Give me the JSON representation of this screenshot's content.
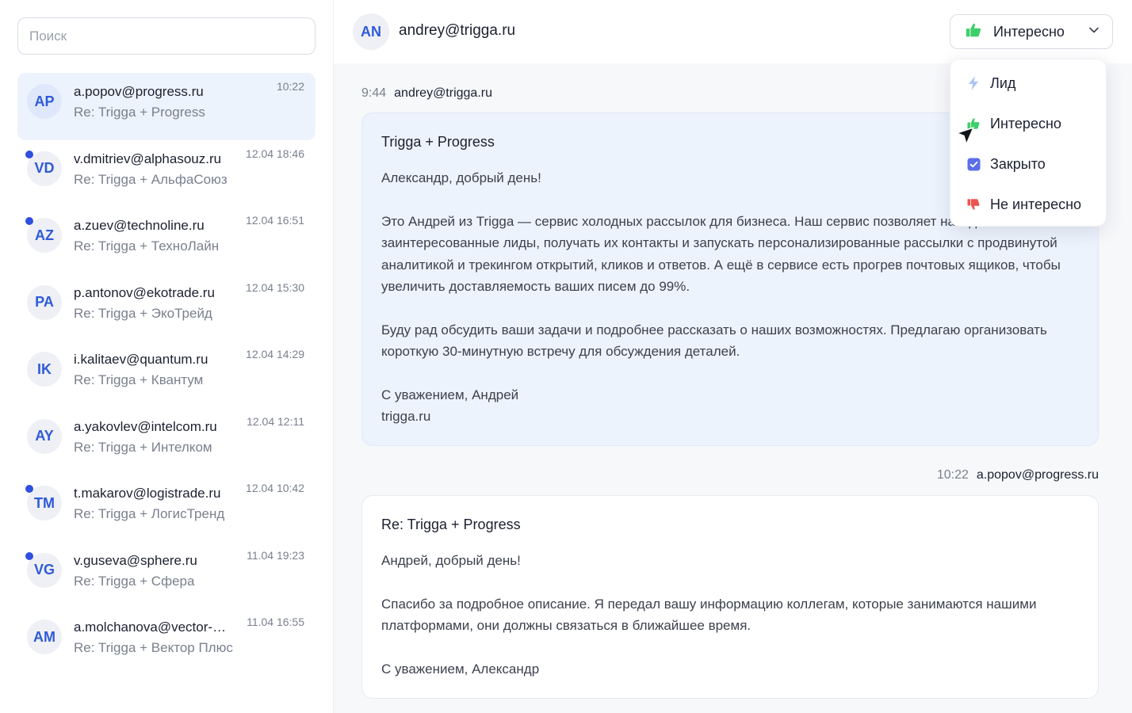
{
  "search": {
    "placeholder": "Поиск"
  },
  "conversations": [
    {
      "initials": "AP",
      "email": "a.popov@progress.ru",
      "subject": "Re: Trigga + Progress",
      "time": "10:22"
    },
    {
      "initials": "VD",
      "email": "v.dmitriev@alphasouz.ru",
      "subject": "Re: Trigga + АльфаСоюз",
      "time": "12.04 18:46"
    },
    {
      "initials": "AZ",
      "email": "a.zuev@technoline.ru",
      "subject": "Re: Trigga + ТехноЛайн",
      "time": "12.04 16:51"
    },
    {
      "initials": "PA",
      "email": "p.antonov@ekotrade.ru",
      "subject": "Re: Trigga + ЭкоТрейд",
      "time": "12.04 15:30"
    },
    {
      "initials": "IK",
      "email": "i.kalitaev@quantum.ru",
      "subject": "Re: Trigga + Квантум",
      "time": "12.04 14:29"
    },
    {
      "initials": "AY",
      "email": "a.yakovlev@intelcom.ru",
      "subject": "Re: Trigga + Интелком",
      "time": "12.04 12:11"
    },
    {
      "initials": "TM",
      "email": "t.makarov@logistrade.ru",
      "subject": "Re: Trigga + ЛогисТренд",
      "time": "12.04 10:42"
    },
    {
      "initials": "VG",
      "email": "v.guseva@sphere.ru",
      "subject": "Re: Trigga + Сфера",
      "time": "11.04 19:23"
    },
    {
      "initials": "AM",
      "email": "a.molchanova@vector-plus.ru",
      "subject": "Re: Trigga + Вектор Плюс",
      "time": "11.04 16:55"
    }
  ],
  "header": {
    "initials": "AN",
    "email": "andrey@trigga.ru",
    "status": "Интересно"
  },
  "messages": {
    "outgoing": {
      "time": "9:44",
      "from": "andrey@trigga.ru",
      "subject": "Trigga + Progress",
      "greeting": "Александр, добрый день!",
      "p1": "Это Андрей из Trigga — сервис холодных рассылок для бизнеса. Наш сервис позволяет находить заинтересованные лиды, получать их контакты и запускать персонализированные рассылки с продвинутой аналитикой и трекингом открытий, кликов и ответов. А ещё в сервисе есть прогрев почтовых ящиков, чтобы увеличить доставляемость ваших писем до 99%.",
      "p2": "Буду рад обсудить ваши задачи и подробнее рассказать о наших возможностях. Предлагаю организовать короткую 30-минутную встречу для обсуждения деталей.",
      "sign1": "С уважением, Андрей",
      "sign2": "trigga.ru"
    },
    "incoming": {
      "time": "10:22",
      "from": "a.popov@progress.ru",
      "subject": "Re: Trigga + Progress",
      "greeting": "Андрей, добрый день!",
      "p1": "Спасибо за подробное описание. Я передал вашу информацию коллегам, которые занимаются нашими платформами, они должны связаться в ближайшее время.",
      "sign1": "С уважением, Александр"
    }
  },
  "dropdown": {
    "items": [
      {
        "label": "Лид",
        "icon": "lightning-icon"
      },
      {
        "label": "Интересно",
        "icon": "thumbs-up-icon"
      },
      {
        "label": "Закрыто",
        "icon": "checkbox-icon"
      },
      {
        "label": "Не интересно",
        "icon": "thumbs-down-icon"
      }
    ]
  },
  "colors": {
    "accent": "#2f4fe0",
    "avatar_text": "#2f5ad8",
    "thumbs_up": "#3ecf6a",
    "thumbs_down": "#ef5350",
    "lightning": "#a9c4f5",
    "checkbox": "#5b6ee8"
  }
}
